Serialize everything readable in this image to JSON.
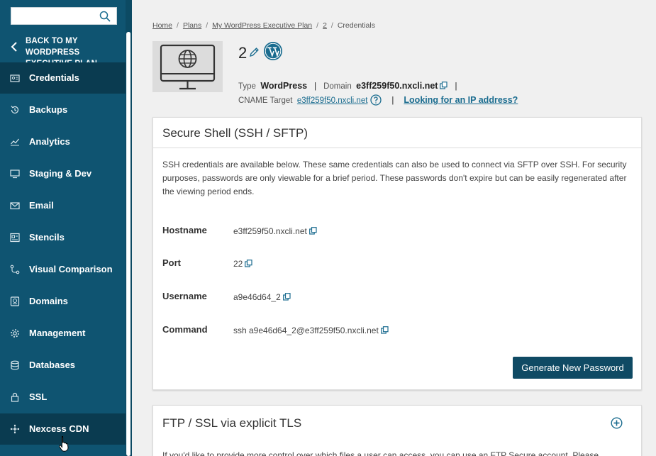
{
  "sidebar": {
    "search": {
      "placeholder": ""
    },
    "back_label": "BACK TO MY WORDPRESS EXECUTIVE PLAN",
    "items": [
      {
        "label": "Credentials",
        "icon": "credentials-icon",
        "active": true
      },
      {
        "label": "Backups",
        "icon": "backups-icon"
      },
      {
        "label": "Analytics",
        "icon": "analytics-icon"
      },
      {
        "label": "Staging & Dev",
        "icon": "staging-icon"
      },
      {
        "label": "Email",
        "icon": "email-icon"
      },
      {
        "label": "Stencils",
        "icon": "stencils-icon"
      },
      {
        "label": "Visual Comparison",
        "icon": "visual-comparison-icon"
      },
      {
        "label": "Domains",
        "icon": "domains-icon"
      },
      {
        "label": "Management",
        "icon": "gear-icon"
      },
      {
        "label": "Databases",
        "icon": "database-icon"
      },
      {
        "label": "SSL",
        "icon": "lock-icon"
      },
      {
        "label": "Nexcess CDN",
        "icon": "cdn-icon"
      }
    ]
  },
  "breadcrumb": [
    "Home",
    "Plans",
    "My WordPress Executive Plan",
    "2",
    "Credentials"
  ],
  "site": {
    "name": "2",
    "type_label": "Type",
    "type_value": "WordPress",
    "domain_label": "Domain",
    "domain_value": "e3ff259f50.nxcli.net",
    "cname_label": "CNAME Target",
    "cname_value": "e3ff259f50.nxcli.net",
    "ip_link": "Looking for an IP address?"
  },
  "ssh": {
    "title": "Secure Shell (SSH / SFTP)",
    "description": "SSH credentials are available below. These same credentials can also be used to connect via SFTP over SSH. For security purposes, passwords are only viewable for a brief period. These passwords don't expire but can be easily regenerated after the viewing period ends.",
    "rows": [
      {
        "key": "Hostname",
        "value": "e3ff259f50.nxcli.net"
      },
      {
        "key": "Port",
        "value": "22"
      },
      {
        "key": "Username",
        "value": "a9e46d64_2"
      },
      {
        "key": "Command",
        "value": "ssh a9e46d64_2@e3ff259f50.nxcli.net"
      }
    ],
    "button": "Generate New Password"
  },
  "ftp": {
    "title": "FTP / SSL via explicit TLS",
    "clipped_text": "If you'd like to provide more control over which files a user can access, you can use an FTP Secure account. Please"
  },
  "colors": {
    "sidebar": "#0f5471",
    "sidebar_active": "#0a3b50",
    "link": "#1a6c8f",
    "button": "#0f4a64"
  }
}
